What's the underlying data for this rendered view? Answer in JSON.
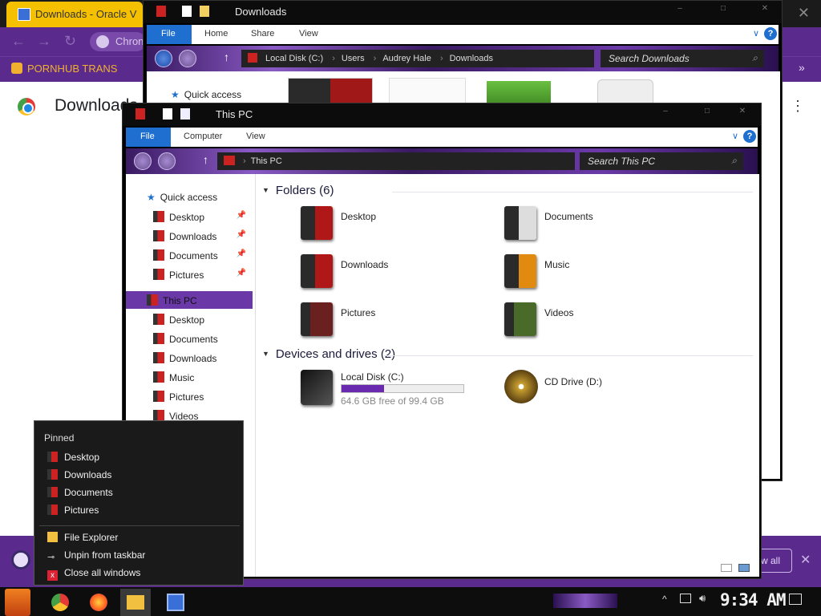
{
  "chrome": {
    "tab_title": "Downloads - Oracle V",
    "close_glyph": "✕",
    "omnibox_chip": "Chron",
    "bookmark": "PORNHUB TRANS",
    "bookmark_overflow": "»",
    "page_title": "Downloads",
    "menu_glyph": "⋮",
    "shelf_button": "w all",
    "shelf_close": "✕",
    "nav_back": "←",
    "nav_forward": "→",
    "nav_reload": "↻"
  },
  "win_downloads": {
    "title": "Downloads",
    "ribbon_tabs": [
      "File",
      "Home",
      "Share",
      "View"
    ],
    "address": [
      "Local Disk (C:)",
      "Users",
      "Audrey Hale",
      "Downloads"
    ],
    "search_placeholder": "Search Downloads",
    "nav_quick_access": "Quick access",
    "min": "–",
    "max": "□",
    "close": "✕"
  },
  "win_thispc": {
    "title": "This PC",
    "ribbon_tabs": [
      "File",
      "Computer",
      "View"
    ],
    "address": "This PC",
    "search_placeholder": "Search This PC",
    "min": "–",
    "max": "□",
    "close": "✕",
    "nav": {
      "quick_access": "Quick access",
      "pinned": [
        {
          "label": "Desktop"
        },
        {
          "label": "Downloads"
        },
        {
          "label": "Documents"
        },
        {
          "label": "Pictures"
        }
      ],
      "this_pc": "This PC",
      "this_pc_items": [
        {
          "label": "Desktop"
        },
        {
          "label": "Documents"
        },
        {
          "label": "Downloads"
        },
        {
          "label": "Music"
        },
        {
          "label": "Pictures"
        },
        {
          "label": "Videos"
        }
      ]
    },
    "folders_header": "Folders (6)",
    "folders": [
      "Desktop",
      "Documents",
      "Downloads",
      "Music",
      "Pictures",
      "Videos"
    ],
    "drives_header": "Devices and drives (2)",
    "drives": [
      {
        "name": "Local Disk (C:)",
        "detail": "64.6 GB free of 99.4 GB",
        "used_fraction": 0.35
      },
      {
        "name": "CD Drive (D:)"
      }
    ]
  },
  "jumplist": {
    "header": "Pinned",
    "pinned": [
      "Desktop",
      "Downloads",
      "Documents",
      "Pictures"
    ],
    "actions": [
      "File Explorer",
      "Unpin from taskbar",
      "Close all windows"
    ]
  },
  "taskbar": {
    "clock": "9:34 AM"
  },
  "colors": {
    "accent_purple": "#5a2a8c",
    "file_tab_blue": "#1e6fd0",
    "chrome_tab_yellow": "#f5c000"
  }
}
